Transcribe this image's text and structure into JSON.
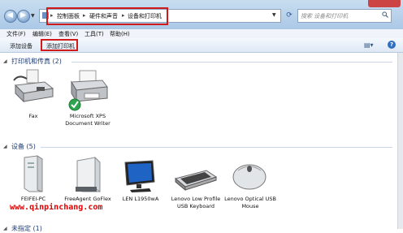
{
  "address": {
    "breadcrumbs": [
      "控制面板",
      "硬件和声音",
      "设备和打印机"
    ],
    "separator": "▸",
    "refresh_icon": "refresh-icon"
  },
  "search": {
    "placeholder": "搜索 设备和打印机"
  },
  "menu": [
    "文件(F)",
    "编辑(E)",
    "查看(V)",
    "工具(T)",
    "帮助(H)"
  ],
  "toolbar": {
    "add_device": "添加设备",
    "add_printer": "添加打印机",
    "help": "?"
  },
  "groups": {
    "printers": {
      "title": "打印机和传真 (2)",
      "items": [
        {
          "label": "Fax",
          "icon": "fax-icon"
        },
        {
          "label": "Microsoft XPS Document Writer",
          "icon": "printer-icon",
          "default": true
        }
      ]
    },
    "devices": {
      "title": "设备 (5)",
      "items": [
        {
          "label": "FEIFEI-PC",
          "icon": "computer-tower-icon"
        },
        {
          "label": "FreeAgent GoFlex",
          "icon": "external-drive-icon"
        },
        {
          "label": "LEN L1950wA",
          "icon": "monitor-icon"
        },
        {
          "label": "Lenovo Low Profile USB Keyboard",
          "icon": "keyboard-icon"
        },
        {
          "label": "Lenovo Optical USB Mouse",
          "icon": "mouse-icon"
        }
      ]
    },
    "unspecified": {
      "title": "未指定 (1)"
    }
  },
  "watermark": "www.qinpinchang.com",
  "colors": {
    "highlight": "#d11a1a",
    "group_title": "#1e3c78"
  }
}
